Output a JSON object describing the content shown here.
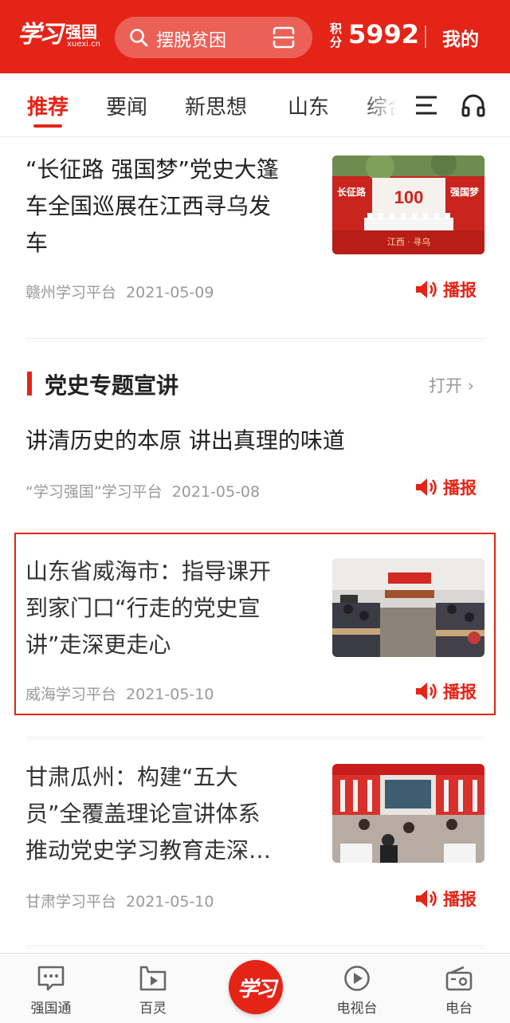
{
  "header": {
    "logo_glyph": "学习",
    "logo_name": "强国",
    "logo_domain": "xuexi.cn",
    "search_text": "摆脱贫困",
    "points_label": "积分",
    "points_value": "5992",
    "mine": "我的"
  },
  "tabs": [
    {
      "label": "推荐",
      "active": true
    },
    {
      "label": "要闻",
      "active": false
    },
    {
      "label": "新思想",
      "active": false
    },
    {
      "label": "山东",
      "active": false
    },
    {
      "label": "综合",
      "active": false
    }
  ],
  "broadcast_label": "播报",
  "articles": [
    {
      "title_lines": [
        "“长征路 强国梦”党史大篷",
        "车全国巡展在江西寻乌发",
        "车"
      ],
      "source": "赣州学习平台",
      "date": "2021-05-09",
      "thumb_texts": [
        "长征路",
        "100",
        "强国梦",
        "江西 · 寻乌"
      ]
    },
    {
      "title_lines": [
        "讲清历史的本原 讲出真理的味道"
      ],
      "source": "“学习强国”学习平台",
      "date": "2021-05-08"
    },
    {
      "title_lines": [
        "山东省威海市：指导课开",
        "到家门口“行走的党史宣",
        "讲”走深更走心"
      ],
      "source": "威海学习平台",
      "date": "2021-05-10"
    },
    {
      "title_lines": [
        "甘肃瓜州：构建“五大",
        "员”全覆盖理论宣讲体系",
        "推动党史学习教育走深…"
      ],
      "source": "甘肃学习平台",
      "date": "2021-05-10"
    }
  ],
  "section": {
    "title": "党史专题宣讲",
    "open_label": "打开 ›"
  },
  "bottom_nav": [
    {
      "label": "强国通",
      "icon": "chat-icon"
    },
    {
      "label": "百灵",
      "icon": "video-icon"
    },
    {
      "label": "电视台",
      "icon": "play-icon"
    },
    {
      "label": "电台",
      "icon": "radio-icon"
    }
  ],
  "center_button_glyph": "学习",
  "colors": {
    "brand_red": "#e42417",
    "meta_gray": "#999999"
  }
}
